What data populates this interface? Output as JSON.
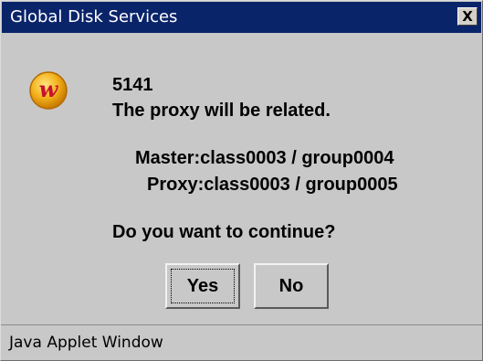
{
  "window": {
    "title": "Global Disk Services",
    "close_label": "X"
  },
  "message": {
    "code": "5141",
    "line": "The proxy will be related.",
    "master": "Master:class0003 / group0004",
    "proxy": "Proxy:class0003 / group0005",
    "question": "Do you want to continue?"
  },
  "buttons": {
    "yes_label": "Yes",
    "no_label": "No"
  },
  "status": {
    "text": "Java Applet Window"
  },
  "icon": {
    "name": "app-logo-icon",
    "glyph": "w",
    "colors": {
      "fill": "#f3b21c",
      "rim": "#b36a00",
      "glyph": "#c8102e"
    }
  },
  "colors": {
    "titlebar": "#0a246a",
    "title_text": "#ffffff",
    "dialog_background": "#c8c8c8"
  }
}
